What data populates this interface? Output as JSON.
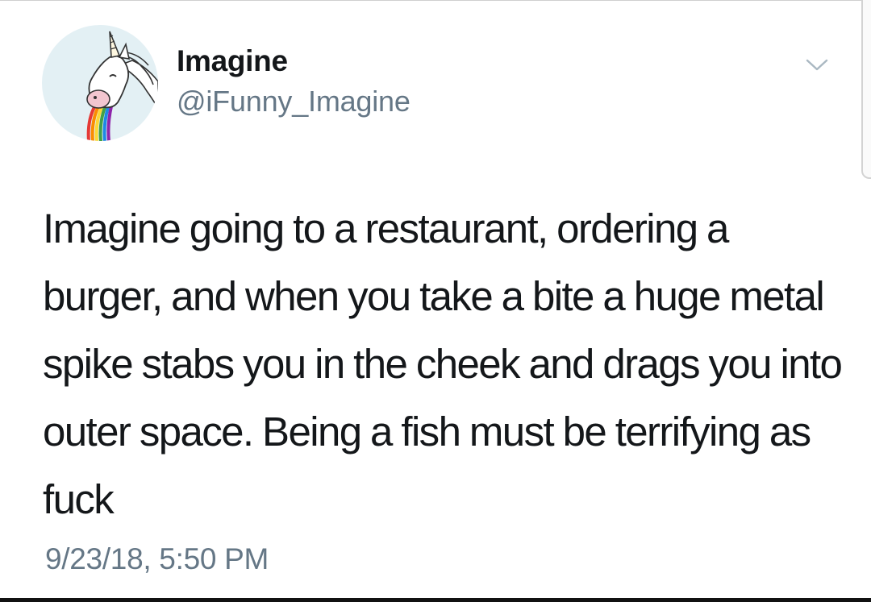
{
  "tweet": {
    "author": {
      "display_name": "Imagine",
      "handle": "@iFunny_Imagine",
      "avatar_icon": "unicorn-rainbow-avatar"
    },
    "menu_icon": "chevron-down-icon",
    "text": "Imagine going to a restaurant, ordering a burger, and when you take a bite a huge metal spike stabs you in the cheek and drags you into outer space. Being a fish must be terrifying as fuck",
    "timestamp": "9/23/18, 5:50 PM"
  },
  "colors": {
    "text_primary": "#14171a",
    "text_secondary": "#657786",
    "background": "#ffffff",
    "avatar_bg": "#e3f0f4"
  }
}
